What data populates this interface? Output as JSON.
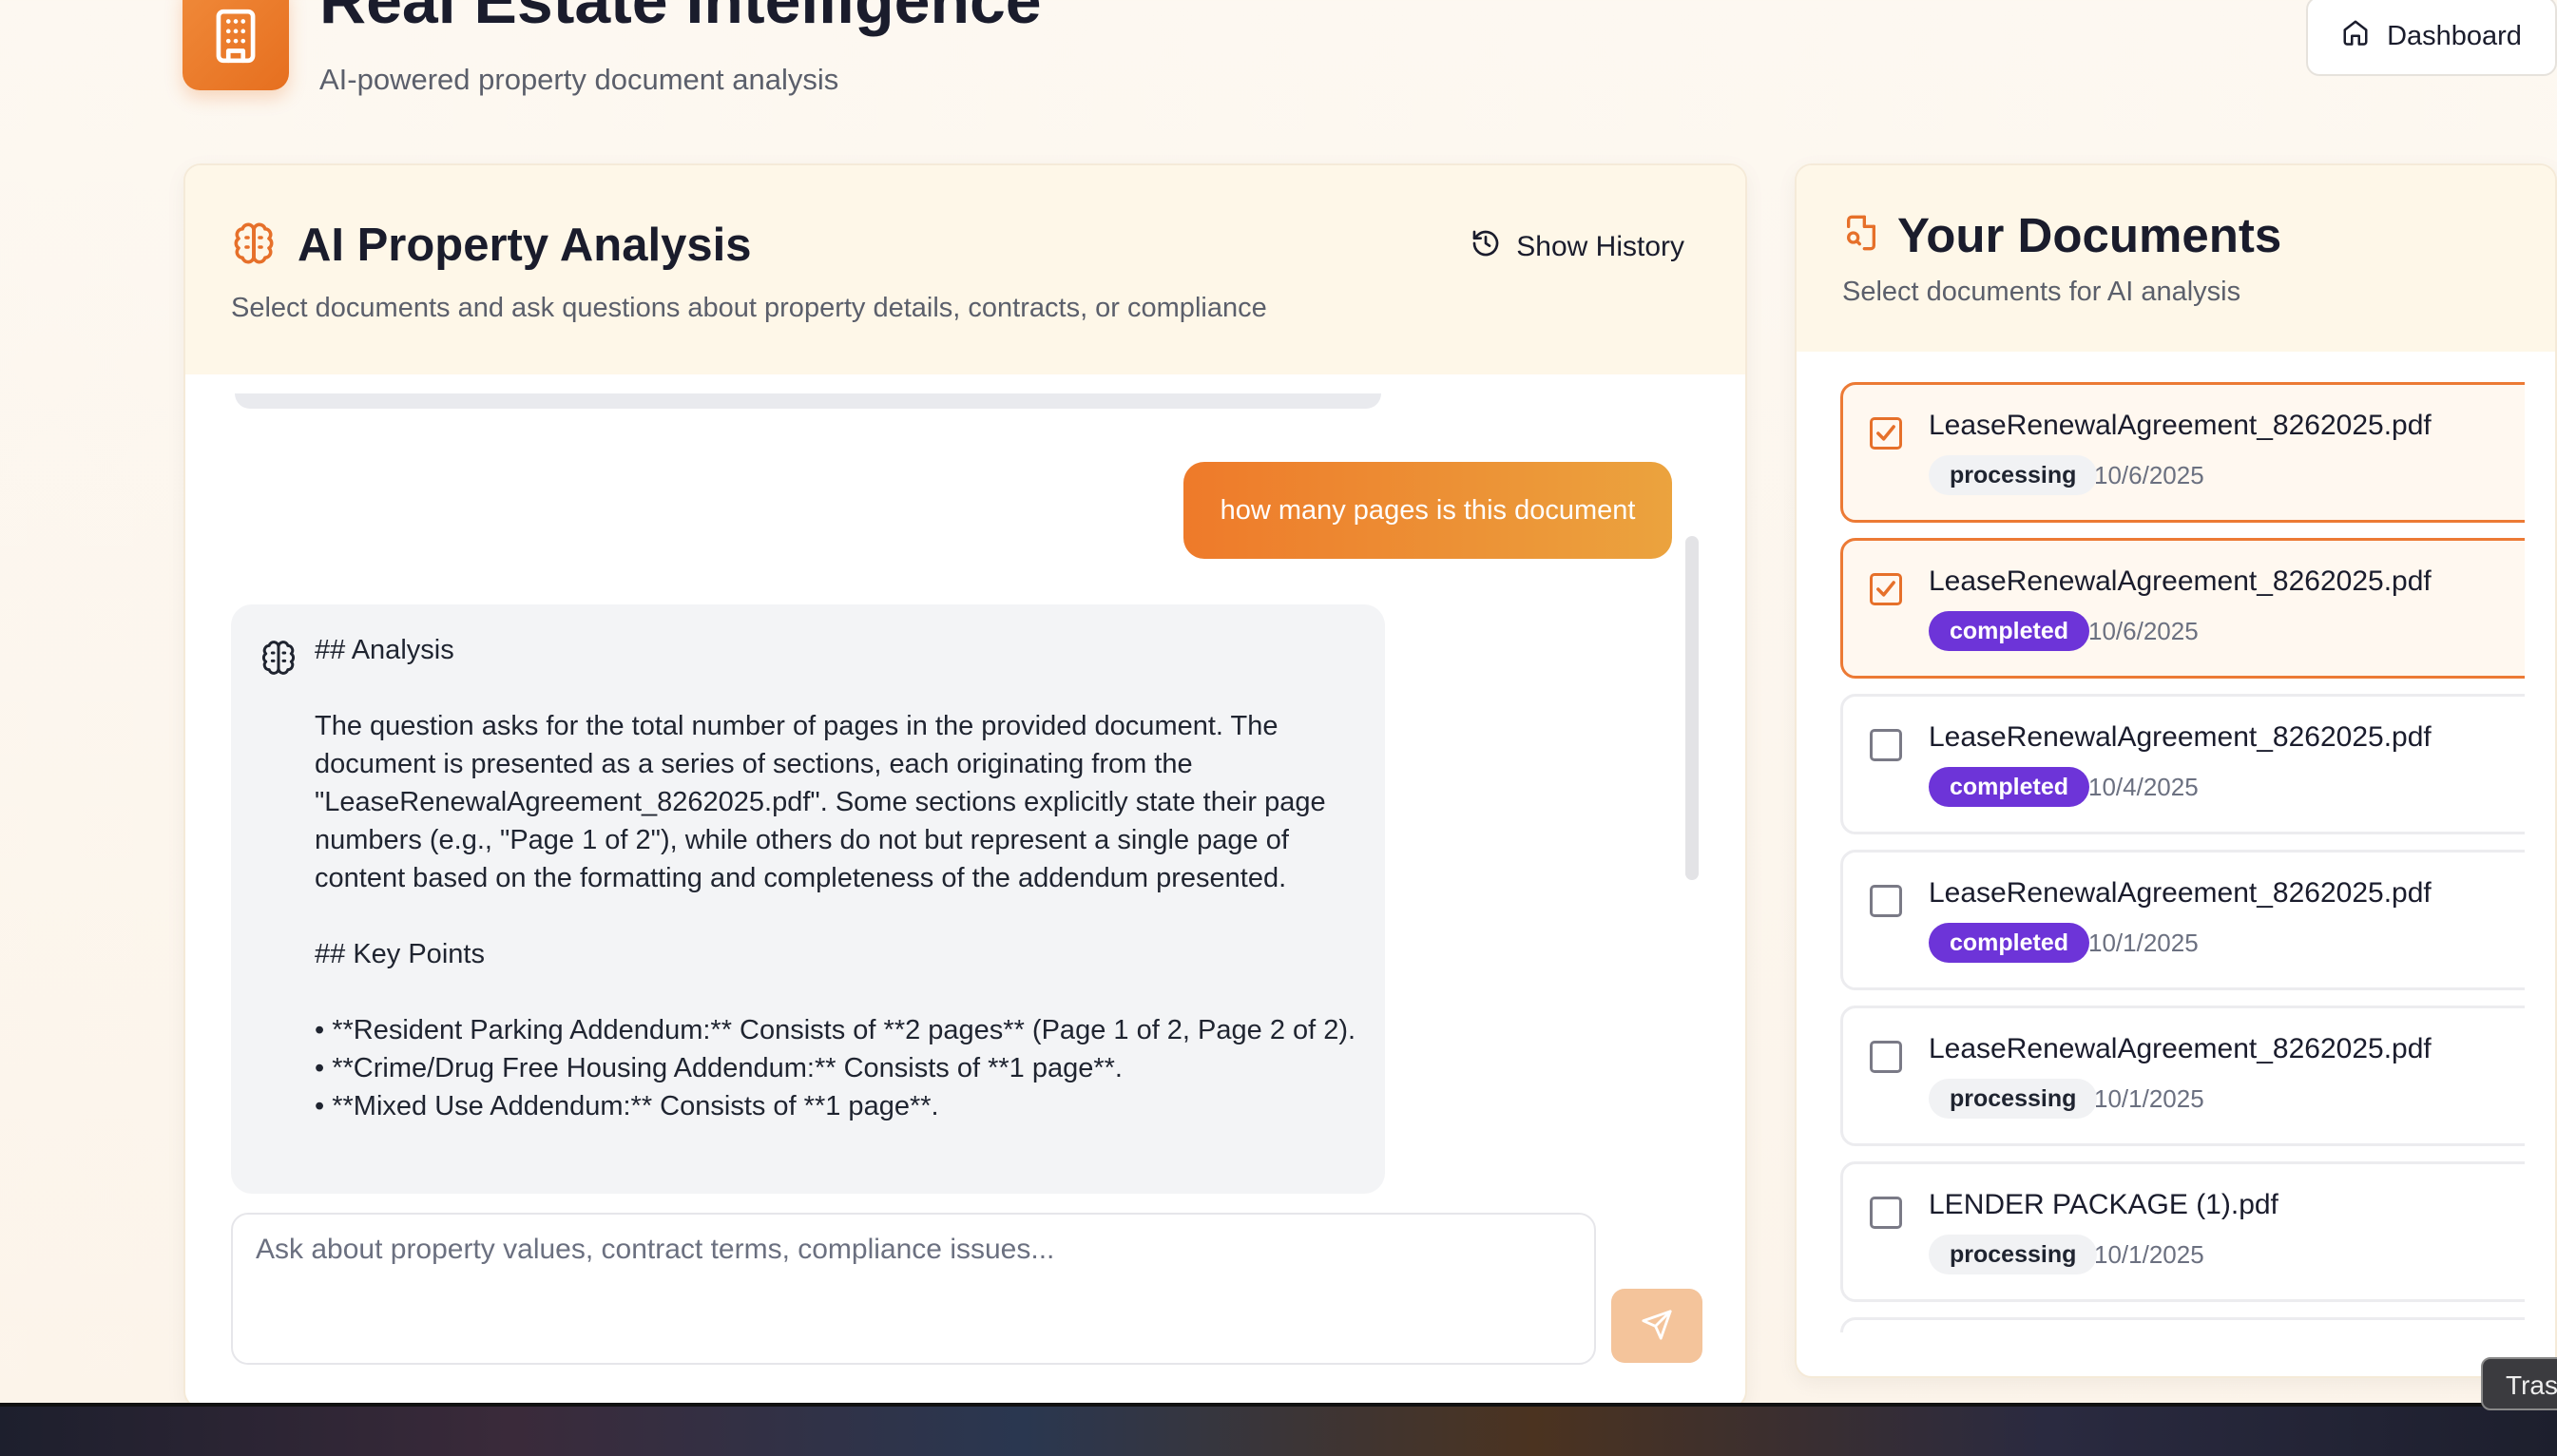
{
  "header": {
    "title": "Real Estate Intelligence",
    "subtitle": "AI-powered property document analysis",
    "dashboard_label": "Dashboard"
  },
  "chat": {
    "title": "AI Property Analysis",
    "description": "Select documents and ask questions about property details, contracts, or compliance",
    "history_label": "Show History",
    "user_message": "how many pages is this document",
    "ai_response": "## Analysis\n\nThe question asks for the total number of pages in the provided document. The document is presented as a series of sections, each originating from the \"LeaseRenewalAgreement_8262025.pdf\". Some sections explicitly state their page numbers (e.g., \"Page 1 of 2\"), while others do not but represent a single page of content based on the formatting and completeness of the addendum presented.\n\n## Key Points\n\n• **Resident Parking Addendum:** Consists of **2 pages** (Page 1 of 2, Page 2 of 2).\n• **Crime/Drug Free Housing Addendum:** Consists of **1 page**.\n• **Mixed Use Addendum:** Consists of **1 page**.",
    "input_placeholder": "Ask about property values, contract terms, compliance issues..."
  },
  "documents": {
    "title": "Your Documents",
    "description": "Select documents for AI analysis",
    "items": [
      {
        "name": "LeaseRenewalAgreement_8262025.pdf",
        "status": "processing",
        "date": "10/6/2025",
        "selected": true
      },
      {
        "name": "LeaseRenewalAgreement_8262025.pdf",
        "status": "completed",
        "date": "10/6/2025",
        "selected": true
      },
      {
        "name": "LeaseRenewalAgreement_8262025.pdf",
        "status": "completed",
        "date": "10/4/2025",
        "selected": false
      },
      {
        "name": "LeaseRenewalAgreement_8262025.pdf",
        "status": "completed",
        "date": "10/1/2025",
        "selected": false
      },
      {
        "name": "LeaseRenewalAgreement_8262025.pdf",
        "status": "processing",
        "date": "10/1/2025",
        "selected": false
      },
      {
        "name": "LENDER PACKAGE (1).pdf",
        "status": "processing",
        "date": "10/1/2025",
        "selected": false
      }
    ]
  },
  "taskbar": {
    "tooltip": "Trash"
  },
  "colors": {
    "accent": "#ec7a35",
    "completed_badge": "#6d34d8",
    "header_bg": "#fef7e8"
  },
  "icons": [
    "building-icon",
    "home-icon",
    "brain-icon",
    "history-icon",
    "document-search-icon",
    "send-icon",
    "checkbox-checked-icon"
  ]
}
